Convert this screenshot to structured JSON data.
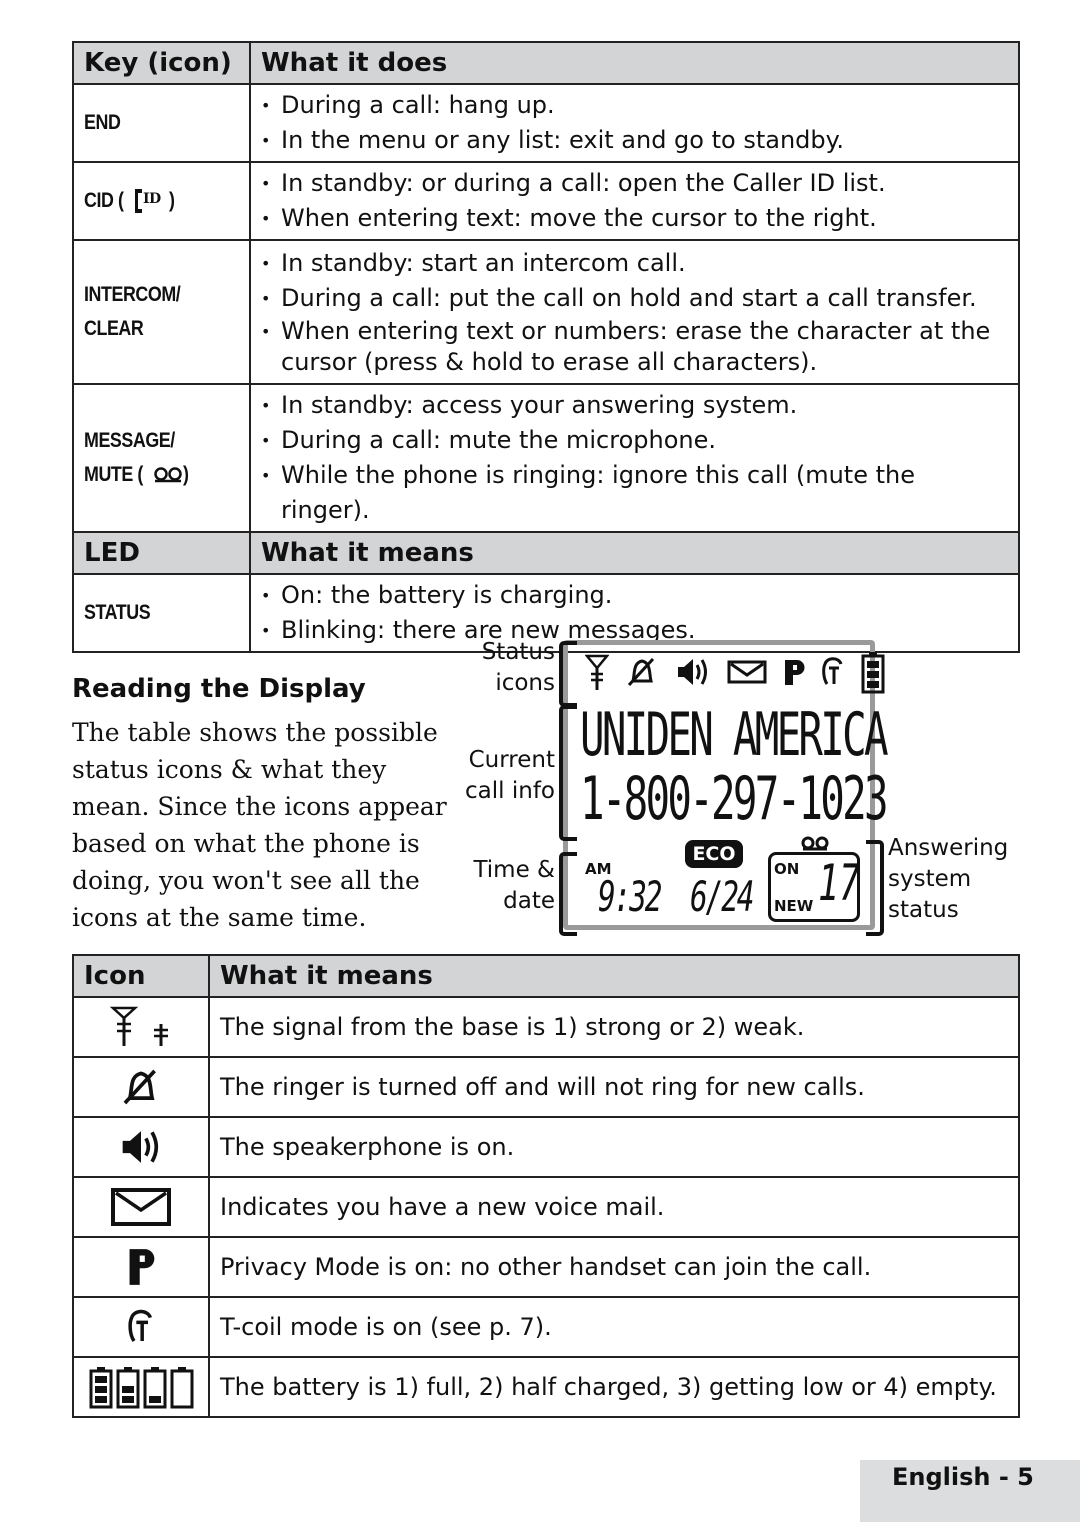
{
  "keys_table": {
    "header": {
      "col1": "Key (icon)",
      "col2": "What it does"
    },
    "rows": [
      {
        "key": "END",
        "key_icon": "",
        "bullets": [
          "During a call: hang up.",
          "In the menu or any list: exit and go to standby."
        ]
      },
      {
        "key": "CID (",
        "key_suffix": ")",
        "key_icon": "caller-id-icon",
        "bullets": [
          "In standby: or during a call: open the Caller ID list.",
          "When entering text: move the cursor to the right."
        ]
      },
      {
        "key": "INTERCOM/",
        "key_line2": "CLEAR",
        "bullets": [
          "In standby: start an intercom call.",
          "During a call: put the call on hold and start a call transfer.",
          "When entering text or numbers: erase the character at the cursor (press & hold to erase all characters)."
        ]
      },
      {
        "key": "MESSAGE/",
        "key_line2": "MUTE (",
        "key_suffix": ")",
        "key_icon": "voicemail-tape-icon",
        "bullets": [
          "In standby: access your answering system.",
          "During a call: mute the microphone.",
          "While the phone is ringing: ignore this call (mute the ringer)."
        ]
      }
    ],
    "led_header": {
      "col1": "LED",
      "col2": "What it means"
    },
    "led_rows": [
      {
        "key": "STATUS",
        "bullets": [
          "On: the battery is charging.",
          "Blinking: there are new messages."
        ]
      }
    ]
  },
  "reading_display": {
    "title": "Reading the Display",
    "body": "The table shows the possible status icons & what they mean. Since the icons appear based on what the phone is doing, you won't see all the icons at the same time."
  },
  "lcd": {
    "labels": {
      "status_icons": [
        "Status",
        "icons"
      ],
      "current_call_info": [
        "Current",
        "call info"
      ],
      "time_date": [
        "Time &",
        "date"
      ],
      "answering_status": [
        "Answering",
        "system",
        "status"
      ]
    },
    "status_icons": [
      "signal-strong-icon",
      "ringer-off-icon",
      "speaker-icon",
      "mail-icon",
      "privacy-icon",
      "tcoil-icon",
      "battery-full-icon"
    ],
    "line1": "UNIDEN AMERICA",
    "line2": "1-800-297-1023",
    "eco": "ECO",
    "am": "AM",
    "time": "9:32",
    "date": "6/24",
    "ans_on": "ON",
    "ans_new": "NEW",
    "ans_count": "17"
  },
  "icons_table": {
    "header": {
      "col1": "Icon",
      "col2": "What it means"
    },
    "rows": [
      {
        "icon": "signal-icon",
        "text": "The signal from the base is 1) strong or 2) weak."
      },
      {
        "icon": "ringer-off-icon",
        "text": "The ringer is turned off and will not ring for new calls."
      },
      {
        "icon": "speaker-icon",
        "text": "The speakerphone is on."
      },
      {
        "icon": "mail-icon",
        "text": "Indicates you have a new voice mail."
      },
      {
        "icon": "privacy-icon",
        "text": "Privacy Mode is on: no other handset can join the call."
      },
      {
        "icon": "tcoil-icon",
        "text": "T-coil mode is on (see p. 7)."
      },
      {
        "icon": "battery-icon",
        "text": "The battery is 1) full, 2) half charged, 3) getting low or 4) empty."
      }
    ]
  },
  "footer": {
    "page_label": "English - 5"
  }
}
